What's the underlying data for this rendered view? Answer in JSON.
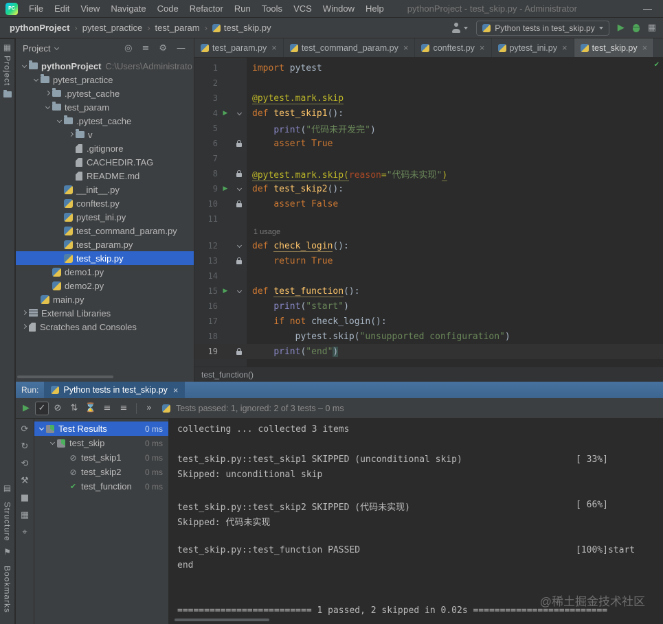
{
  "menubar": {
    "logo_text": "PC",
    "items": [
      "File",
      "Edit",
      "View",
      "Navigate",
      "Code",
      "Refactor",
      "Run",
      "Tools",
      "VCS",
      "Window",
      "Help"
    ],
    "window_title": "pythonProject - test_skip.py - Administrator",
    "minimize_glyph": "—"
  },
  "navbar": {
    "breadcrumbs": [
      "pythonProject",
      "pytest_practice",
      "test_param",
      "test_skip.py"
    ],
    "separator": "›",
    "run_config": "Python tests in test_skip.py"
  },
  "left_strip": {
    "top_icon": "▦",
    "top_label": "Project",
    "structure_icon": "▤",
    "structure_label": "Structure",
    "bookmarks_icon": "⚑",
    "bookmarks_label": "Bookmarks"
  },
  "project_panel": {
    "title": "Project",
    "header_icons": [
      {
        "glyph": "◎",
        "name": "locate-file-icon"
      },
      {
        "glyph": "≡",
        "name": "collapse-all-icon"
      },
      {
        "glyph": "⚙",
        "name": "settings-gear-icon"
      },
      {
        "glyph": "—",
        "name": "hide-panel-icon"
      }
    ],
    "tree": [
      {
        "indent": 0,
        "chev": "down",
        "icon": "project",
        "label": "pythonProject",
        "extra": "C:\\Users\\Administrato",
        "bold": true
      },
      {
        "indent": 1,
        "chev": "down",
        "icon": "folder",
        "label": "pytest_practice"
      },
      {
        "indent": 2,
        "chev": "right",
        "icon": "folder",
        "label": ".pytest_cache"
      },
      {
        "indent": 2,
        "chev": "down",
        "icon": "folder",
        "label": "test_param"
      },
      {
        "indent": 3,
        "chev": "down",
        "icon": "folder",
        "label": ".pytest_cache"
      },
      {
        "indent": 4,
        "chev": "right",
        "icon": "folder",
        "label": "v"
      },
      {
        "indent": 4,
        "icon": "file",
        "label": ".gitignore"
      },
      {
        "indent": 4,
        "icon": "file",
        "label": "CACHEDIR.TAG"
      },
      {
        "indent": 4,
        "icon": "md",
        "label": "README.md"
      },
      {
        "indent": 3,
        "icon": "py",
        "label": "__init__.py"
      },
      {
        "indent": 3,
        "icon": "py",
        "label": "conftest.py"
      },
      {
        "indent": 3,
        "icon": "py",
        "label": "pytest_ini.py"
      },
      {
        "indent": 3,
        "icon": "py",
        "label": "test_command_param.py"
      },
      {
        "indent": 3,
        "icon": "py",
        "label": "test_param.py"
      },
      {
        "indent": 3,
        "icon": "py",
        "label": "test_skip.py",
        "selected": true
      },
      {
        "indent": 2,
        "icon": "py",
        "label": "demo1.py"
      },
      {
        "indent": 2,
        "icon": "py",
        "label": "demo2.py"
      },
      {
        "indent": 1,
        "icon": "py",
        "label": "main.py"
      },
      {
        "indent": 0,
        "chev": "right",
        "icon": "lib",
        "label": "External Libraries"
      },
      {
        "indent": 0,
        "chev": "right",
        "icon": "scratch",
        "label": "Scratches and Consoles"
      }
    ]
  },
  "editor": {
    "tabs": [
      {
        "label": "test_param.py",
        "active": false
      },
      {
        "label": "test_command_param.py",
        "active": false
      },
      {
        "label": "conftest.py",
        "active": false
      },
      {
        "label": "pytest_ini.py",
        "active": false
      },
      {
        "label": "test_skip.py",
        "active": true
      }
    ],
    "close_glyph": "×",
    "rows": [
      {
        "num": 1,
        "seg": [
          [
            "k",
            "import"
          ],
          [
            "n",
            " pytest"
          ]
        ]
      },
      {
        "num": 2,
        "seg": []
      },
      {
        "num": 3,
        "seg": [
          [
            "du",
            "@pytest.mark.skip"
          ]
        ]
      },
      {
        "num": 4,
        "run": true,
        "fold": true,
        "seg": [
          [
            "k",
            "def "
          ],
          [
            "fn",
            "test_skip1"
          ],
          [
            "n",
            "():"
          ]
        ]
      },
      {
        "num": 5,
        "seg": [
          [
            "n",
            "    "
          ],
          [
            "b",
            "print"
          ],
          [
            "n",
            "("
          ],
          [
            "s",
            "\"代码未开发完\""
          ],
          [
            "n",
            ")"
          ]
        ]
      },
      {
        "num": 6,
        "lock": true,
        "seg": [
          [
            "n",
            "    "
          ],
          [
            "k",
            "assert"
          ],
          [
            "n",
            " "
          ],
          [
            "k",
            "True"
          ]
        ]
      },
      {
        "num": 7,
        "seg": []
      },
      {
        "num": 8,
        "lock": true,
        "seg": [
          [
            "du",
            "@pytest.mark.skip("
          ],
          [
            "arg",
            "reason"
          ],
          [
            "d",
            "="
          ],
          [
            "s",
            "\"代码未实现\""
          ],
          [
            "du",
            ")"
          ]
        ]
      },
      {
        "num": 9,
        "run": true,
        "fold": true,
        "seg": [
          [
            "k",
            "def "
          ],
          [
            "fn",
            "test_skip2"
          ],
          [
            "n",
            "():"
          ]
        ]
      },
      {
        "num": 10,
        "lock": true,
        "seg": [
          [
            "n",
            "    "
          ],
          [
            "k",
            "assert"
          ],
          [
            "n",
            " "
          ],
          [
            "k",
            "False"
          ]
        ]
      },
      {
        "num": 11,
        "seg": []
      },
      {
        "inlay": "1 usage"
      },
      {
        "num": 12,
        "fold": true,
        "seg": [
          [
            "k",
            "def "
          ],
          [
            "fnu",
            "check_login"
          ],
          [
            "n",
            "():"
          ]
        ]
      },
      {
        "num": 13,
        "lock": true,
        "seg": [
          [
            "n",
            "    "
          ],
          [
            "k",
            "return"
          ],
          [
            "n",
            " "
          ],
          [
            "k",
            "True"
          ]
        ]
      },
      {
        "num": 14,
        "seg": []
      },
      {
        "num": 15,
        "run": true,
        "fold": true,
        "seg": [
          [
            "k",
            "def "
          ],
          [
            "fnu",
            "test_function"
          ],
          [
            "n",
            "():"
          ]
        ]
      },
      {
        "num": 16,
        "seg": [
          [
            "n",
            "    "
          ],
          [
            "b",
            "print"
          ],
          [
            "n",
            "("
          ],
          [
            "s",
            "\"start\""
          ],
          [
            "n",
            ")"
          ]
        ]
      },
      {
        "num": 17,
        "seg": [
          [
            "n",
            "    "
          ],
          [
            "k",
            "if"
          ],
          [
            "n",
            " "
          ],
          [
            "k",
            "not"
          ],
          [
            "n",
            " check_login():"
          ]
        ]
      },
      {
        "num": 18,
        "seg": [
          [
            "n",
            "        pytest.skip("
          ],
          [
            "s",
            "\"unsupported configuration\""
          ],
          [
            "n",
            ")"
          ]
        ]
      },
      {
        "num": 19,
        "current": true,
        "lock": true,
        "seg": [
          [
            "n",
            "    "
          ],
          [
            "b",
            "print"
          ],
          [
            "n",
            "("
          ],
          [
            "s",
            "\"end\""
          ],
          [
            "hl",
            ")"
          ]
        ]
      }
    ],
    "inspection_ok": "✔",
    "breadcrumb": "test_function()"
  },
  "run_panel": {
    "header_label": "Run:",
    "tab_label": "Python tests in test_skip.py",
    "toolbar_icons": [
      {
        "g": "▶",
        "name": "rerun-tests-icon",
        "cls": "grn"
      },
      {
        "g": "✓",
        "name": "show-passed-toggle",
        "cls": "box"
      },
      {
        "g": "⊘",
        "name": "show-ignored-toggle"
      },
      {
        "g": "⇅",
        "name": "sort-alphabetically-icon"
      },
      {
        "g": "⌛",
        "name": "sort-by-duration-icon"
      },
      {
        "g": "≡",
        "name": "expand-all-icon"
      },
      {
        "g": "≡",
        "name": "collapse-all-icon"
      },
      {
        "g": "",
        "name": "toolbar-divider",
        "cls": "sep"
      },
      {
        "g": "»",
        "name": "more-options-icon"
      }
    ],
    "status": "Tests passed: 1, ignored: 2 of 3 tests – 0 ms",
    "side_icons": [
      {
        "g": "⟳",
        "name": "rerun-icon"
      },
      {
        "g": "↻",
        "name": "rerun-failed-icon"
      },
      {
        "g": "⟲",
        "name": "auto-test-icon"
      },
      {
        "g": "⚒",
        "name": "test-settings-icon"
      },
      {
        "g": "■",
        "name": "stop-icon"
      },
      {
        "g": "▦",
        "name": "layout-icon"
      },
      {
        "g": "⌖",
        "name": "pin-icon"
      }
    ],
    "tree": [
      {
        "indent": 0,
        "chev": "down",
        "icon": "results",
        "label": "Test Results",
        "time": "0 ms",
        "selected": true
      },
      {
        "indent": 1,
        "chev": "down",
        "icon": "suite",
        "label": "test_skip",
        "time": "0 ms"
      },
      {
        "indent": 2,
        "icon": "skip",
        "label": "test_skip1",
        "time": "0 ms"
      },
      {
        "indent": 2,
        "icon": "skip",
        "label": "test_skip2",
        "time": "0 ms"
      },
      {
        "indent": 2,
        "icon": "pass",
        "label": "test_function",
        "time": "0 ms"
      }
    ],
    "console": {
      "lines": [
        {
          "t": "collecting ... collected 3 items"
        },
        {
          "t": ""
        },
        {
          "t": "test_skip.py::test_skip1 SKIPPED (unconditional skip)",
          "r": "[ 33%]"
        },
        {
          "t": "Skipped: unconditional skip"
        },
        {
          "t": ""
        },
        {
          "t": "test_skip.py::test_skip2 SKIPPED (代码未实现)",
          "r": "[ 66%]"
        },
        {
          "t": "Skipped: 代码未实现"
        },
        {
          "t": ""
        },
        {
          "t": "test_skip.py::test_function PASSED",
          "r": "[100%]start"
        },
        {
          "t": "end"
        },
        {
          "t": ""
        },
        {
          "t": ""
        },
        {
          "t": "========================= 1 passed, 2 skipped in 0.02s ========================="
        }
      ],
      "watermark": "@稀土掘金技术社区"
    }
  }
}
